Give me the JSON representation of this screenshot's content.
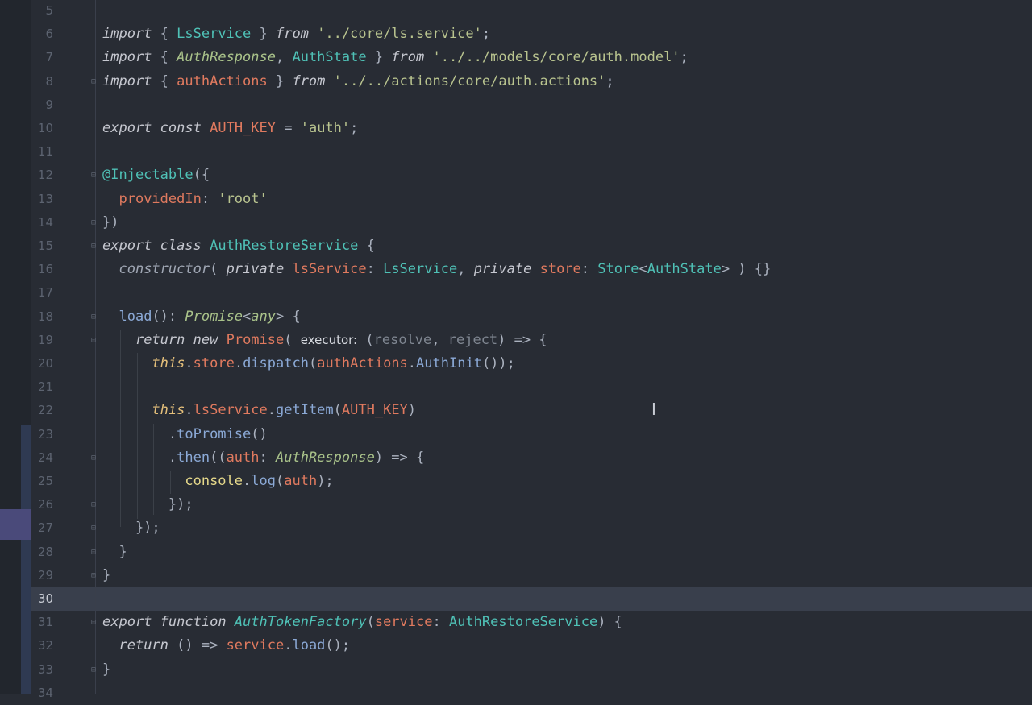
{
  "editor": {
    "language": "typescript",
    "current_line": "30",
    "lines": [
      {
        "n": "5",
        "code": ""
      },
      {
        "n": "6",
        "code": "import { LsService } from '../core/ls.service';"
      },
      {
        "n": "7",
        "code": "import { AuthResponse, AuthState } from '../../models/core/auth.model';"
      },
      {
        "n": "8",
        "code": "import { authActions } from '../../actions/core/auth.actions';"
      },
      {
        "n": "9",
        "code": ""
      },
      {
        "n": "10",
        "code": "export const AUTH_KEY = 'auth';"
      },
      {
        "n": "11",
        "code": ""
      },
      {
        "n": "12",
        "code": "@Injectable({"
      },
      {
        "n": "13",
        "code": "  providedIn: 'root'"
      },
      {
        "n": "14",
        "code": "})"
      },
      {
        "n": "15",
        "code": "export class AuthRestoreService {"
      },
      {
        "n": "16",
        "code": "  constructor( private lsService: LsService, private store: Store<AuthState> ) {}"
      },
      {
        "n": "17",
        "code": ""
      },
      {
        "n": "18",
        "code": "  load(): Promise<any> {"
      },
      {
        "n": "19",
        "code": "    return new Promise( executor: (resolve, reject) => {"
      },
      {
        "n": "20",
        "code": "      this.store.dispatch(authActions.AuthInit());"
      },
      {
        "n": "21",
        "code": ""
      },
      {
        "n": "22",
        "code": "      this.lsService.getItem(AUTH_KEY)"
      },
      {
        "n": "23",
        "code": "        .toPromise()"
      },
      {
        "n": "24",
        "code": "        .then((auth: AuthResponse) => {"
      },
      {
        "n": "25",
        "code": "          console.log(auth);"
      },
      {
        "n": "26",
        "code": "        });"
      },
      {
        "n": "27",
        "code": "    });"
      },
      {
        "n": "28",
        "code": "  }"
      },
      {
        "n": "29",
        "code": "}"
      },
      {
        "n": "30",
        "code": ""
      },
      {
        "n": "31",
        "code": "export function AuthTokenFactory(service: AuthRestoreService) {"
      },
      {
        "n": "32",
        "code": "  return () => service.load();"
      },
      {
        "n": "33",
        "code": "}"
      },
      {
        "n": "34",
        "code": ""
      }
    ]
  },
  "icons": {
    "fold": "fold-marker-icon",
    "cursor": "text-cursor-icon"
  },
  "colors": {
    "background": "#282c34",
    "current_line": "#393f4c",
    "keyword": "#c6c8d0",
    "class": "#4fc1b6",
    "string": "#b9c48f",
    "identifier": "#e07a5f"
  }
}
